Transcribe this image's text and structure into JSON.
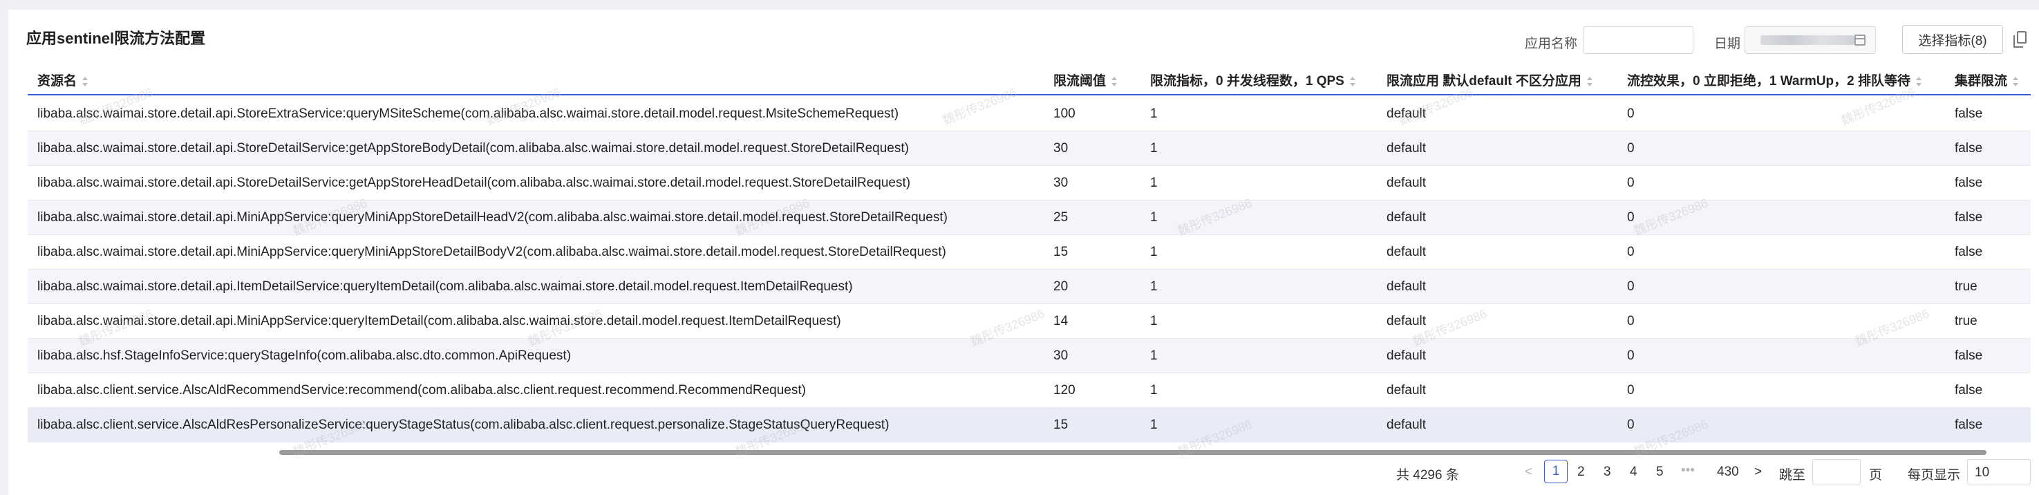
{
  "title": "应用sentinel限流方法配置",
  "filters": {
    "app_label": "应用名称",
    "app_value": "",
    "date_label": "日期",
    "select_metrics_button": "选择指标(8)"
  },
  "table": {
    "headers": [
      "资源名",
      "限流阈值",
      "限流指标，0 并发线程数，1 QPS",
      "限流应用 默认default 不区分应用",
      "流控效果，0 立即拒绝，1 WarmUp，2 排队等待",
      "集群限流"
    ],
    "rows": [
      [
        "libaba.alsc.waimai.store.detail.api.StoreExtraService:queryMSiteScheme(com.alibaba.alsc.waimai.store.detail.model.request.MsiteSchemeRequest)",
        "100",
        "1",
        "default",
        "0",
        "false"
      ],
      [
        "libaba.alsc.waimai.store.detail.api.StoreDetailService:getAppStoreBodyDetail(com.alibaba.alsc.waimai.store.detail.model.request.StoreDetailRequest)",
        "30",
        "1",
        "default",
        "0",
        "false"
      ],
      [
        "libaba.alsc.waimai.store.detail.api.StoreDetailService:getAppStoreHeadDetail(com.alibaba.alsc.waimai.store.detail.model.request.StoreDetailRequest)",
        "30",
        "1",
        "default",
        "0",
        "false"
      ],
      [
        "libaba.alsc.waimai.store.detail.api.MiniAppService:queryMiniAppStoreDetailHeadV2(com.alibaba.alsc.waimai.store.detail.model.request.StoreDetailRequest)",
        "25",
        "1",
        "default",
        "0",
        "false"
      ],
      [
        "libaba.alsc.waimai.store.detail.api.MiniAppService:queryMiniAppStoreDetailBodyV2(com.alibaba.alsc.waimai.store.detail.model.request.StoreDetailRequest)",
        "15",
        "1",
        "default",
        "0",
        "false"
      ],
      [
        "libaba.alsc.waimai.store.detail.api.ItemDetailService:queryItemDetail(com.alibaba.alsc.waimai.store.detail.model.request.ItemDetailRequest)",
        "20",
        "1",
        "default",
        "0",
        "true"
      ],
      [
        "libaba.alsc.waimai.store.detail.api.MiniAppService:queryItemDetail(com.alibaba.alsc.waimai.store.detail.model.request.ItemDetailRequest)",
        "14",
        "1",
        "default",
        "0",
        "true"
      ],
      [
        "libaba.alsc.hsf.StageInfoService:queryStageInfo(com.alibaba.alsc.dto.common.ApiRequest)",
        "30",
        "1",
        "default",
        "0",
        "false"
      ],
      [
        "libaba.alsc.client.service.AlscAldRecommendService:recommend(com.alibaba.alsc.client.request.recommend.RecommendRequest)",
        "120",
        "1",
        "default",
        "0",
        "false"
      ],
      [
        "libaba.alsc.client.service.AlscAldResPersonalizeService:queryStageStatus(com.alibaba.alsc.client.request.personalize.StageStatusQueryRequest)",
        "15",
        "1",
        "default",
        "0",
        "false"
      ]
    ]
  },
  "pagination": {
    "total": "共 4296 条",
    "prev": "<",
    "pages": [
      "1",
      "2",
      "3",
      "4",
      "5"
    ],
    "ellipsis": "•••",
    "last_page": "430",
    "next": ">",
    "goto_label": "跳至",
    "goto_value": "",
    "page_unit": "页",
    "page_size_label": "每页显示",
    "page_size_value": "10"
  },
  "watermark": "魏彤传326986"
}
